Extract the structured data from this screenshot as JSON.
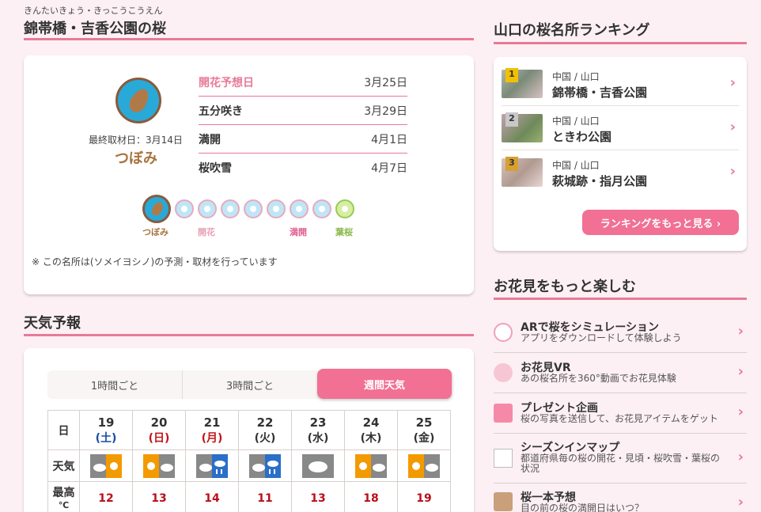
{
  "spot": {
    "ruby": "きんたいきょう・きっこうこうえん",
    "title": "錦帯橋・吉香公園の桜"
  },
  "bloom": {
    "last_date": "最終取材日：3月14日",
    "status": "つぼみ",
    "forecast": [
      {
        "label": "開花予想日",
        "value": "3月25日"
      },
      {
        "label": "五分咲き",
        "value": "3月29日"
      },
      {
        "label": "満開",
        "value": "4月1日"
      },
      {
        "label": "桜吹雪",
        "value": "4月7日"
      }
    ],
    "stage_labels": {
      "bud": "つぼみ",
      "open": "開花",
      "full": "満開",
      "leaf": "葉桜"
    },
    "note": "※ この名所は(ソメイヨシノ)の予測・取材を行っています"
  },
  "weather": {
    "title": "天気予報",
    "tabs": [
      "1時間ごと",
      "3時間ごと",
      "週間天気"
    ],
    "active_tab": 2,
    "row_labels": {
      "day": "日",
      "weather": "天気",
      "high": "最高",
      "unit": "℃"
    },
    "days": [
      {
        "num": "19",
        "wd": "(土)",
        "kind": "sat",
        "icon": "cloudy-then-sunny-icon",
        "high": "12"
      },
      {
        "num": "20",
        "wd": "(日)",
        "kind": "sun",
        "icon": "sunny-then-cloudy-icon",
        "high": "13"
      },
      {
        "num": "21",
        "wd": "(月)",
        "kind": "sun",
        "icon": "cloudy-then-rain-icon",
        "high": "14"
      },
      {
        "num": "22",
        "wd": "(火)",
        "kind": "wk",
        "icon": "cloudy-then-rain-icon",
        "high": "11"
      },
      {
        "num": "23",
        "wd": "(水)",
        "kind": "wk",
        "icon": "cloudy-icon",
        "high": "13"
      },
      {
        "num": "24",
        "wd": "(木)",
        "kind": "wk",
        "icon": "sunny-then-cloudy-icon",
        "high": "18"
      },
      {
        "num": "25",
        "wd": "(金)",
        "kind": "wk",
        "icon": "sunny-then-cloudy-icon",
        "high": "19"
      }
    ]
  },
  "ranking": {
    "title": "山口の桜名所ランキング",
    "items": [
      {
        "rank": "1",
        "region": "中国 / 山口",
        "name": "錦帯橋・吉香公園"
      },
      {
        "rank": "2",
        "region": "中国 / 山口",
        "name": "ときわ公園"
      },
      {
        "rank": "3",
        "region": "中国 / 山口",
        "name": "萩城跡・指月公園"
      }
    ],
    "more_label": "ランキングをもっと見る ›"
  },
  "enjoy": {
    "title": "お花見をもっと楽しむ",
    "items": [
      {
        "title": "ARで桜をシミュレーション",
        "sub": "アプリをダウンロードして体験しよう"
      },
      {
        "title": "お花見VR",
        "sub": "あの桜名所を360°動画でお花見体験"
      },
      {
        "title": "プレゼント企画",
        "sub": "桜の写真を送信して、お花見アイテムをゲット"
      },
      {
        "title": "シーズンインマップ",
        "sub": "都道府県毎の桜の開花・見頃・桜吹雪・葉桜の状況"
      },
      {
        "title": "桜一本予想",
        "sub": "目の前の桜の満開日はいつ？"
      }
    ]
  },
  "colors": {
    "accent": "#f17094",
    "line": "#e87a98",
    "bg": "#fdf0f4"
  }
}
